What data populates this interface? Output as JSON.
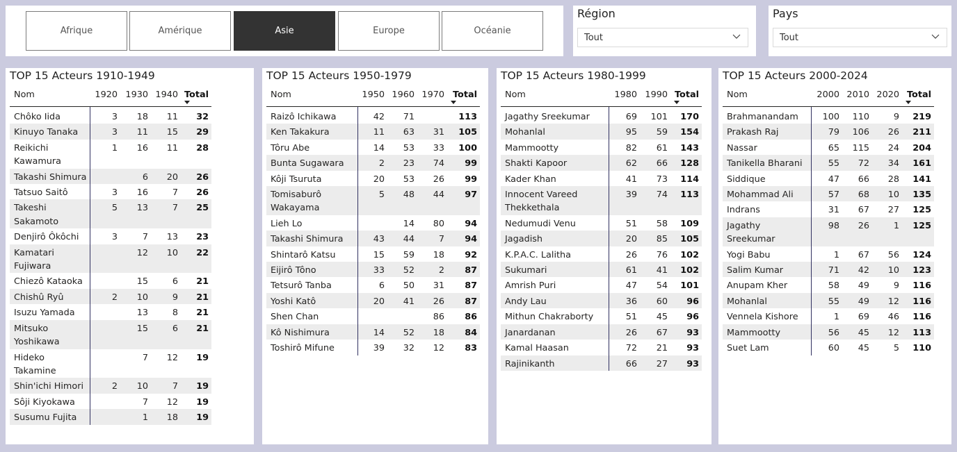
{
  "region_buttons": [
    "Afrique",
    "Amérique",
    "Asie",
    "Europe",
    "Océanie"
  ],
  "active_region": "Asie",
  "colors": {
    "background": "#cbcbdf",
    "active_button": "#333333",
    "row_stripe": "#ececec",
    "divider": "#303060"
  },
  "slicers": {
    "region": {
      "title": "Région",
      "value": "Tout",
      "icon": "chevron-down-icon"
    },
    "pays": {
      "title": "Pays",
      "value": "Tout",
      "icon": "chevron-down-icon"
    }
  },
  "tables": [
    {
      "title": "TOP 15 Acteurs 1910-1949",
      "columns": [
        "Nom",
        "1920",
        "1930",
        "1940",
        "Total"
      ],
      "rows": [
        [
          "Chôko Iida",
          "3",
          "18",
          "11",
          "32"
        ],
        [
          "Kinuyo Tanaka",
          "3",
          "11",
          "15",
          "29"
        ],
        [
          "Reikichi Kawamura",
          "1",
          "16",
          "11",
          "28"
        ],
        [
          "Takashi Shimura",
          "",
          "6",
          "20",
          "26"
        ],
        [
          "Tatsuo Saitô",
          "3",
          "16",
          "7",
          "26"
        ],
        [
          "Takeshi Sakamoto",
          "5",
          "13",
          "7",
          "25"
        ],
        [
          "Denjirô Ôkôchi",
          "3",
          "7",
          "13",
          "23"
        ],
        [
          "Kamatari Fujiwara",
          "",
          "12",
          "10",
          "22"
        ],
        [
          "Chiezô Kataoka",
          "",
          "15",
          "6",
          "21"
        ],
        [
          "Chishû Ryû",
          "2",
          "10",
          "9",
          "21"
        ],
        [
          "Isuzu Yamada",
          "",
          "13",
          "8",
          "21"
        ],
        [
          "Mitsuko Yoshikawa",
          "",
          "15",
          "6",
          "21"
        ],
        [
          "Hideko Takamine",
          "",
          "7",
          "12",
          "19"
        ],
        [
          "Shin'ichi Himori",
          "2",
          "10",
          "7",
          "19"
        ],
        [
          "Sôji Kiyokawa",
          "",
          "7",
          "12",
          "19"
        ],
        [
          "Susumu Fujita",
          "",
          "1",
          "18",
          "19"
        ]
      ]
    },
    {
      "title": "TOP 15 Acteurs 1950-1979",
      "columns": [
        "Nom",
        "1950",
        "1960",
        "1970",
        "Total"
      ],
      "rows": [
        [
          "Raizô Ichikawa",
          "42",
          "71",
          "",
          "113"
        ],
        [
          "Ken Takakura",
          "11",
          "63",
          "31",
          "105"
        ],
        [
          "Tôru Abe",
          "14",
          "53",
          "33",
          "100"
        ],
        [
          "Bunta Sugawara",
          "2",
          "23",
          "74",
          "99"
        ],
        [
          "Kôji Tsuruta",
          "20",
          "53",
          "26",
          "99"
        ],
        [
          "Tomisaburô Wakayama",
          "5",
          "48",
          "44",
          "97"
        ],
        [
          "Lieh Lo",
          "",
          "14",
          "80",
          "94"
        ],
        [
          "Takashi Shimura",
          "43",
          "44",
          "7",
          "94"
        ],
        [
          "Shintarô Katsu",
          "15",
          "59",
          "18",
          "92"
        ],
        [
          "Eijirô Tôno",
          "33",
          "52",
          "2",
          "87"
        ],
        [
          "Tetsurô Tanba",
          "6",
          "50",
          "31",
          "87"
        ],
        [
          "Yoshi Katô",
          "20",
          "41",
          "26",
          "87"
        ],
        [
          "Shen Chan",
          "",
          "",
          "86",
          "86"
        ],
        [
          "Kô Nishimura",
          "14",
          "52",
          "18",
          "84"
        ],
        [
          "Toshirô Mifune",
          "39",
          "32",
          "12",
          "83"
        ]
      ]
    },
    {
      "title": "TOP 15 Acteurs 1980-1999",
      "columns": [
        "Nom",
        "1980",
        "1990",
        "Total"
      ],
      "rows": [
        [
          "Jagathy Sreekumar",
          "69",
          "101",
          "170"
        ],
        [
          "Mohanlal",
          "95",
          "59",
          "154"
        ],
        [
          "Mammootty",
          "82",
          "61",
          "143"
        ],
        [
          "Shakti Kapoor",
          "62",
          "66",
          "128"
        ],
        [
          "Kader Khan",
          "41",
          "73",
          "114"
        ],
        [
          "Innocent Vareed Thekkethala",
          "39",
          "74",
          "113"
        ],
        [
          "Nedumudi Venu",
          "51",
          "58",
          "109"
        ],
        [
          "Jagadish",
          "20",
          "85",
          "105"
        ],
        [
          "K.P.A.C. Lalitha",
          "26",
          "76",
          "102"
        ],
        [
          "Sukumari",
          "61",
          "41",
          "102"
        ],
        [
          "Amrish Puri",
          "47",
          "54",
          "101"
        ],
        [
          "Andy Lau",
          "36",
          "60",
          "96"
        ],
        [
          "Mithun Chakraborty",
          "51",
          "45",
          "96"
        ],
        [
          "Janardanan",
          "26",
          "67",
          "93"
        ],
        [
          "Kamal Haasan",
          "72",
          "21",
          "93"
        ],
        [
          "Rajinikanth",
          "66",
          "27",
          "93"
        ]
      ]
    },
    {
      "title": "TOP 15 Acteurs 2000-2024",
      "columns": [
        "Nom",
        "2000",
        "2010",
        "2020",
        "Total"
      ],
      "rows": [
        [
          "Brahmanandam",
          "100",
          "110",
          "9",
          "219"
        ],
        [
          "Prakash Raj",
          "79",
          "106",
          "26",
          "211"
        ],
        [
          "Nassar",
          "65",
          "115",
          "24",
          "204"
        ],
        [
          "Tanikella Bharani",
          "55",
          "72",
          "34",
          "161"
        ],
        [
          "Siddique",
          "47",
          "66",
          "28",
          "141"
        ],
        [
          "Mohammad Ali",
          "57",
          "68",
          "10",
          "135"
        ],
        [
          "Indrans",
          "31",
          "67",
          "27",
          "125"
        ],
        [
          "Jagathy Sreekumar",
          "98",
          "26",
          "1",
          "125"
        ],
        [
          "Yogi Babu",
          "1",
          "67",
          "56",
          "124"
        ],
        [
          "Salim Kumar",
          "71",
          "42",
          "10",
          "123"
        ],
        [
          "Anupam Kher",
          "58",
          "49",
          "9",
          "116"
        ],
        [
          "Mohanlal",
          "55",
          "49",
          "12",
          "116"
        ],
        [
          "Vennela Kishore",
          "1",
          "69",
          "46",
          "116"
        ],
        [
          "Mammootty",
          "56",
          "45",
          "12",
          "113"
        ],
        [
          "Suet Lam",
          "60",
          "45",
          "5",
          "110"
        ]
      ]
    }
  ]
}
